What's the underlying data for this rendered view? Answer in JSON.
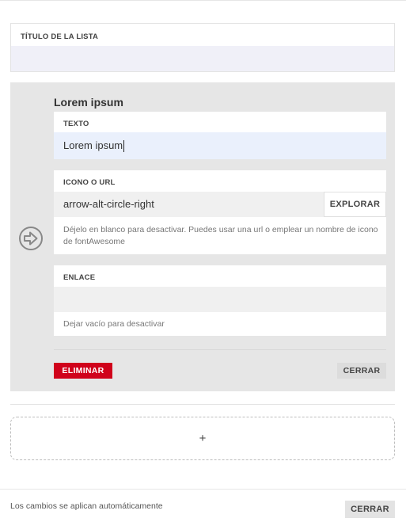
{
  "title_field": {
    "label": "TÍTULO DE LA LISTA",
    "value": ""
  },
  "item": {
    "title": "Lorem ipsum",
    "icon": "arrow-alt-circle-right-icon",
    "texto": {
      "label": "TEXTO",
      "value": "Lorem ipsum"
    },
    "icono": {
      "label": "ICONO O URL",
      "value": "arrow-alt-circle-right",
      "explore_label": "EXPLORAR",
      "help": "Déjelo en blanco para desactivar. Puedes usar una url o emplear un nombre de icono de fontAwesome"
    },
    "enlace": {
      "label": "ENLACE",
      "value": "",
      "help": "Dejar vacío para desactivar"
    },
    "delete_label": "ELIMINAR",
    "close_label": "CERRAR"
  },
  "add_label": "+",
  "footer": {
    "note": "Los cambios se aplican automáticamente",
    "close_label": "CERRAR"
  },
  "colors": {
    "delete_button": "#d0021b",
    "panel_bg": "#e6e6e6",
    "active_input_bg": "#eaf0fc"
  }
}
